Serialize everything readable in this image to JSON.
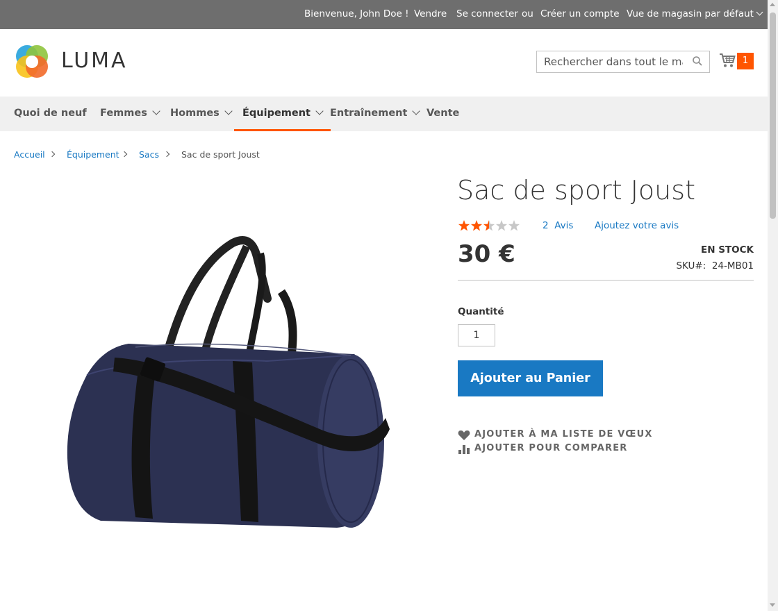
{
  "topbar": {
    "welcome": "Bienvenue, John Doe !",
    "sell": "Vendre",
    "login": "Se connecter",
    "or": "ou",
    "create_account": "Créer un compte",
    "store_view": "Vue de magasin par défaut"
  },
  "header": {
    "logo_text": "LUMA",
    "search_placeholder": "Rechercher dans tout le magasin...",
    "cart_count": "1"
  },
  "nav": {
    "items": [
      {
        "label": "Quoi de neuf",
        "has_submenu": false
      },
      {
        "label": "Femmes",
        "has_submenu": true
      },
      {
        "label": "Hommes",
        "has_submenu": true
      },
      {
        "label": "Équipement",
        "has_submenu": true,
        "active": true
      },
      {
        "label": "Entraînement",
        "has_submenu": true
      },
      {
        "label": "Vente",
        "has_submenu": false
      }
    ]
  },
  "breadcrumb": {
    "items": [
      "Accueil",
      "Équipement",
      "Sacs",
      "Sac de sport Joust"
    ]
  },
  "product": {
    "title": "Sac de sport Joust",
    "rating": 2.5,
    "rating_max": 5,
    "reviews_count": "2",
    "reviews_label": "Avis",
    "add_review": "Ajoutez votre avis",
    "price": "30 €",
    "stock": "En stock",
    "sku_label": "SKU#:",
    "sku": "24-MB01",
    "qty_label": "Quantité",
    "qty_value": "1",
    "add_to_cart": "Ajouter au Panier",
    "wishlist": "AJOUTER À MA LISTE DE VŒUX",
    "compare": "AJOUTER POUR COMPARER"
  },
  "colors": {
    "accent": "#ff5501",
    "link": "#1979c3",
    "topbar_bg": "#6e6e6e",
    "nav_bg": "#f0f0f0"
  },
  "icons": {
    "search": "search-icon",
    "cart": "cart-icon",
    "wishlist": "heart-icon",
    "compare": "bar-chart-icon"
  }
}
